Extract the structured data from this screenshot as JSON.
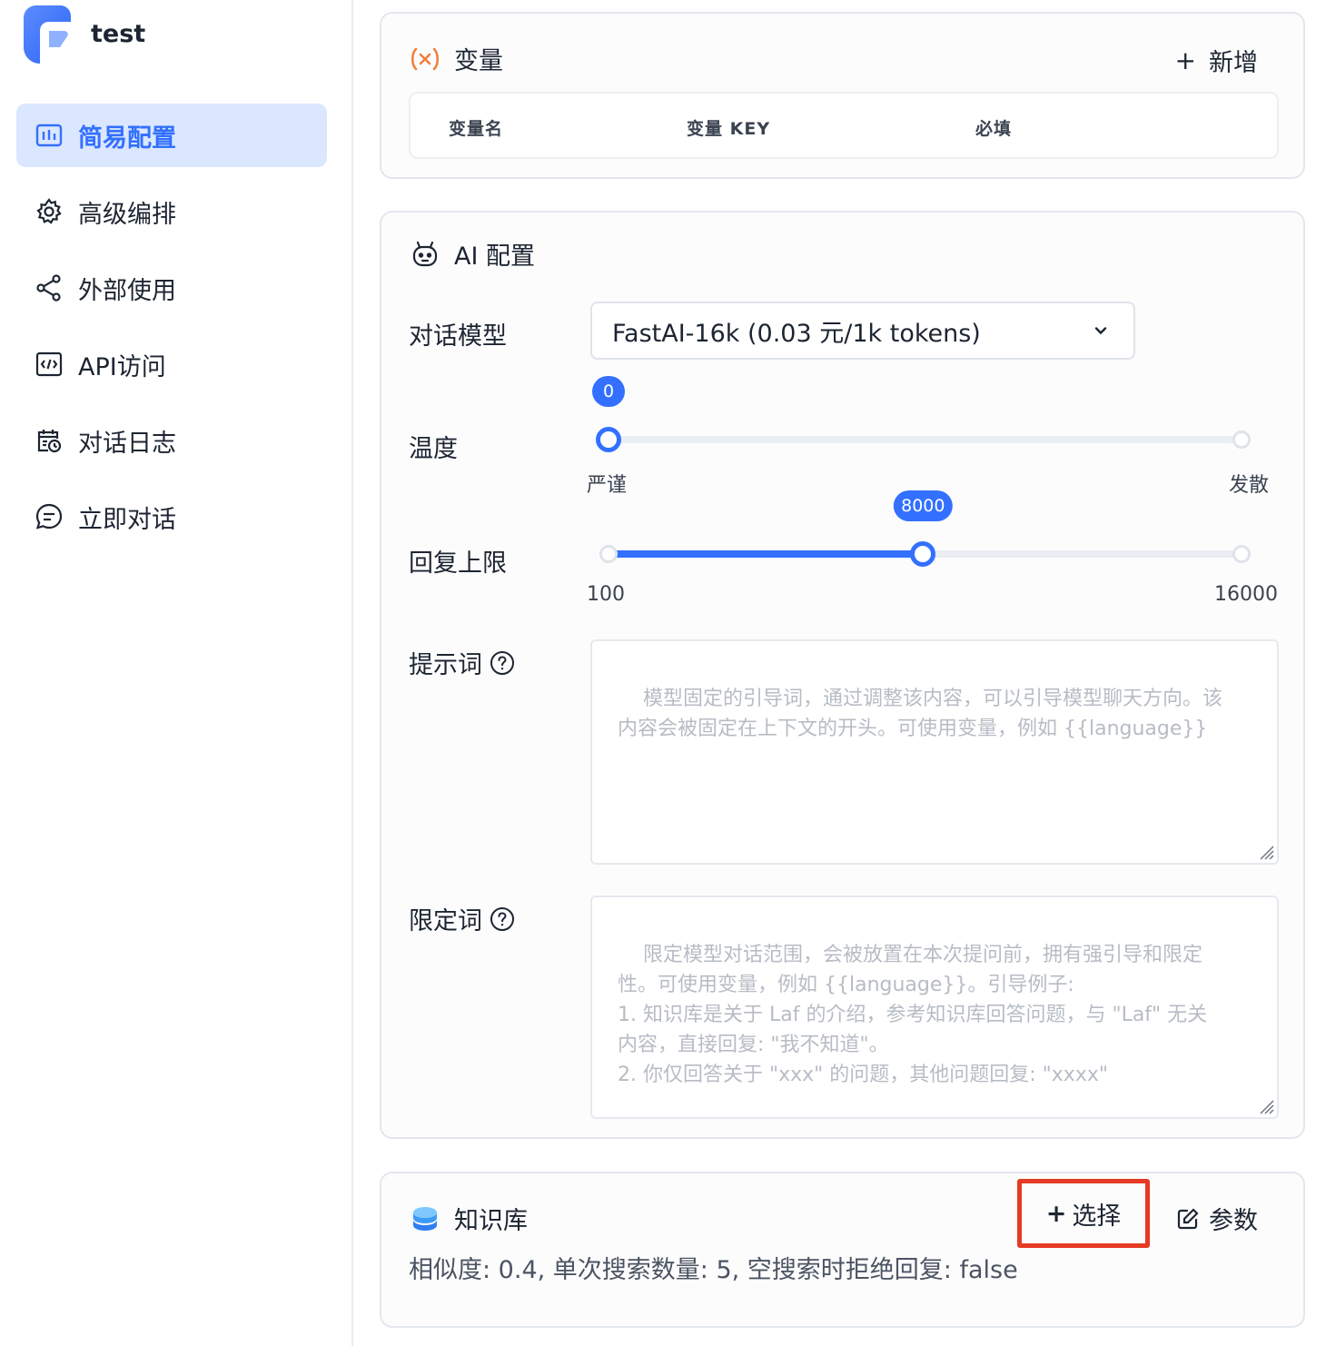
{
  "app": {
    "name": "test"
  },
  "sidebar": {
    "items": [
      {
        "label": "简易配置",
        "icon": "bar-chart-icon",
        "active": true
      },
      {
        "label": "高级编排",
        "icon": "gear-icon"
      },
      {
        "label": "外部使用",
        "icon": "share-icon"
      },
      {
        "label": "API访问",
        "icon": "code-icon"
      },
      {
        "label": "对话日志",
        "icon": "calendar-clock-icon"
      },
      {
        "label": "立即对话",
        "icon": "chat-icon"
      }
    ]
  },
  "variables": {
    "title": "变量",
    "add_label": "新增",
    "columns": [
      "变量名",
      "变量 KEY",
      "必填"
    ]
  },
  "ai_config": {
    "title": "AI 配置",
    "model_label": "对话模型",
    "model_value": "FastAI-16k (0.03 元/1k tokens)",
    "temperature": {
      "label": "温度",
      "value": "0",
      "fraction": 0,
      "min_label": "严谨",
      "max_label": "发散"
    },
    "max_tokens": {
      "label": "回复上限",
      "value": "8000",
      "min": 100,
      "max": 16000,
      "min_label": "100",
      "max_label": "16000"
    },
    "prompt": {
      "label": "提示词",
      "placeholder": "模型固定的引导词，通过调整该内容，可以引导模型聊天方向。该\n内容会被固定在上下文的开头。可使用变量，例如 {{language}}"
    },
    "limit": {
      "label": "限定词",
      "placeholder": "限定模型对话范围，会被放置在本次提问前，拥有强引导和限定\n性。可使用变量，例如 {{language}}。引导例子:\n1. 知识库是关于 Laf 的介绍，参考知识库回答问题，与 \"Laf\" 无关\n内容，直接回复: \"我不知道\"。\n2. 你仅回答关于 \"xxx\" 的问题，其他问题回复: \"xxxx\""
    }
  },
  "knowledge": {
    "title": "知识库",
    "select_label": "选择",
    "params_label": "参数",
    "summary": "相似度: 0.4, 单次搜索数量: 5, 空搜索时拒绝回复: false"
  },
  "colors": {
    "accent": "#3370ff",
    "highlight_border": "#e53a24",
    "variable_icon": "#f07f3c"
  }
}
